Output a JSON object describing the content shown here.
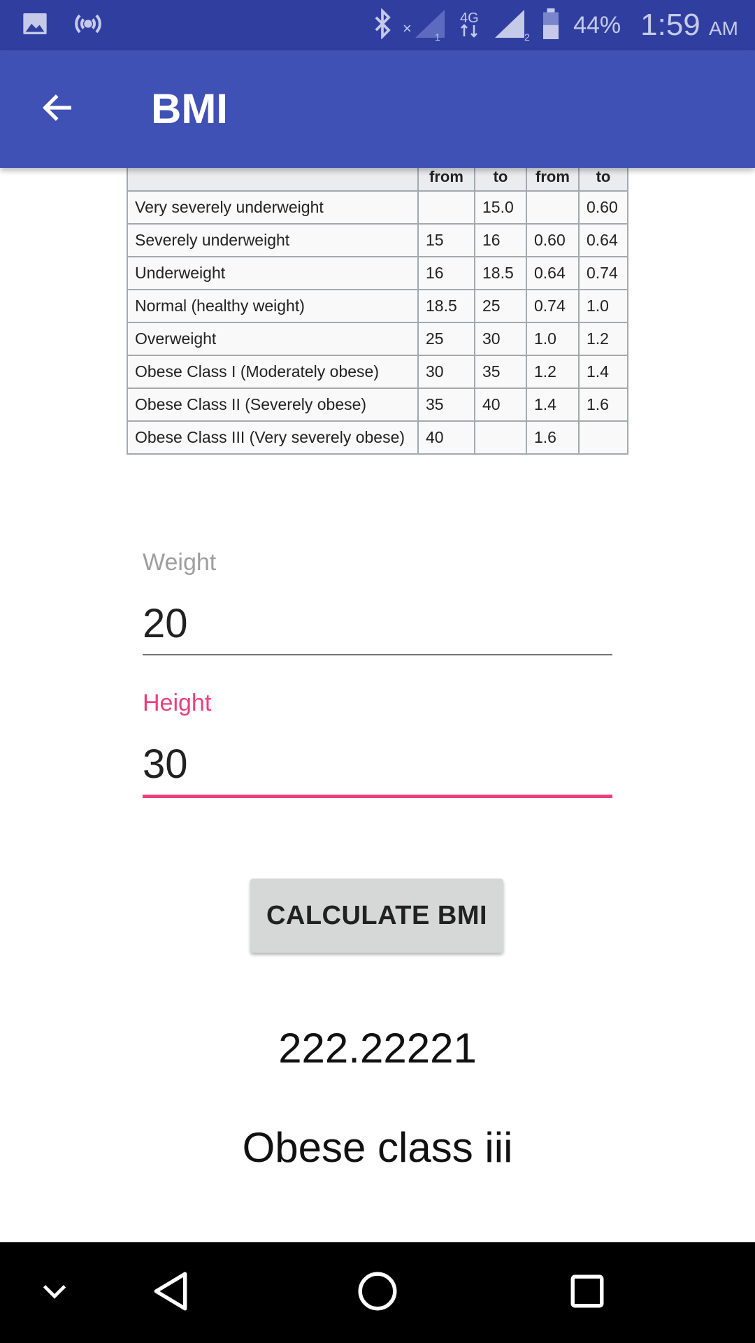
{
  "status_bar": {
    "battery_percent": "44%",
    "time": "1:59",
    "ampm": "AM",
    "network_type": "4G",
    "sim1_index": "1",
    "sim2_index": "2",
    "icons": [
      "image-notification-icon",
      "hotspot-icon",
      "bluetooth-icon",
      "signal-sim1-icon",
      "signal-sim2-icon",
      "battery-icon"
    ]
  },
  "app_bar": {
    "title": "BMI",
    "background_color": "#3f51b5",
    "status_color": "#303f9f"
  },
  "bmi_table": {
    "headers": [
      "",
      "from",
      "to",
      "from",
      "to"
    ],
    "rows": [
      [
        "Very severely underweight",
        "",
        "15.0",
        "",
        "0.60"
      ],
      [
        "Severely underweight",
        "15",
        "16",
        "0.60",
        "0.64"
      ],
      [
        "Underweight",
        "16",
        "18.5",
        "0.64",
        "0.74"
      ],
      [
        "Normal (healthy weight)",
        "18.5",
        "25",
        "0.74",
        "1.0"
      ],
      [
        "Overweight",
        "25",
        "30",
        "1.0",
        "1.2"
      ],
      [
        "Obese Class I (Moderately obese)",
        "30",
        "35",
        "1.2",
        "1.4"
      ],
      [
        "Obese Class II (Severely obese)",
        "35",
        "40",
        "1.4",
        "1.6"
      ],
      [
        "Obese Class III (Very severely obese)",
        "40",
        "",
        "1.6",
        ""
      ]
    ]
  },
  "form": {
    "weight_label": "Weight",
    "weight_value": "20",
    "height_label": "Height",
    "height_value": "30",
    "accent_color": "#ec407a",
    "calculate_label": "CALCULATE BMI"
  },
  "result": {
    "bmi_value": "222.22221",
    "category": "Obese class iii"
  },
  "nav_bar": {
    "icons": [
      "hide-keyboard-icon",
      "back-triangle-icon",
      "home-circle-icon",
      "recents-square-icon"
    ]
  }
}
